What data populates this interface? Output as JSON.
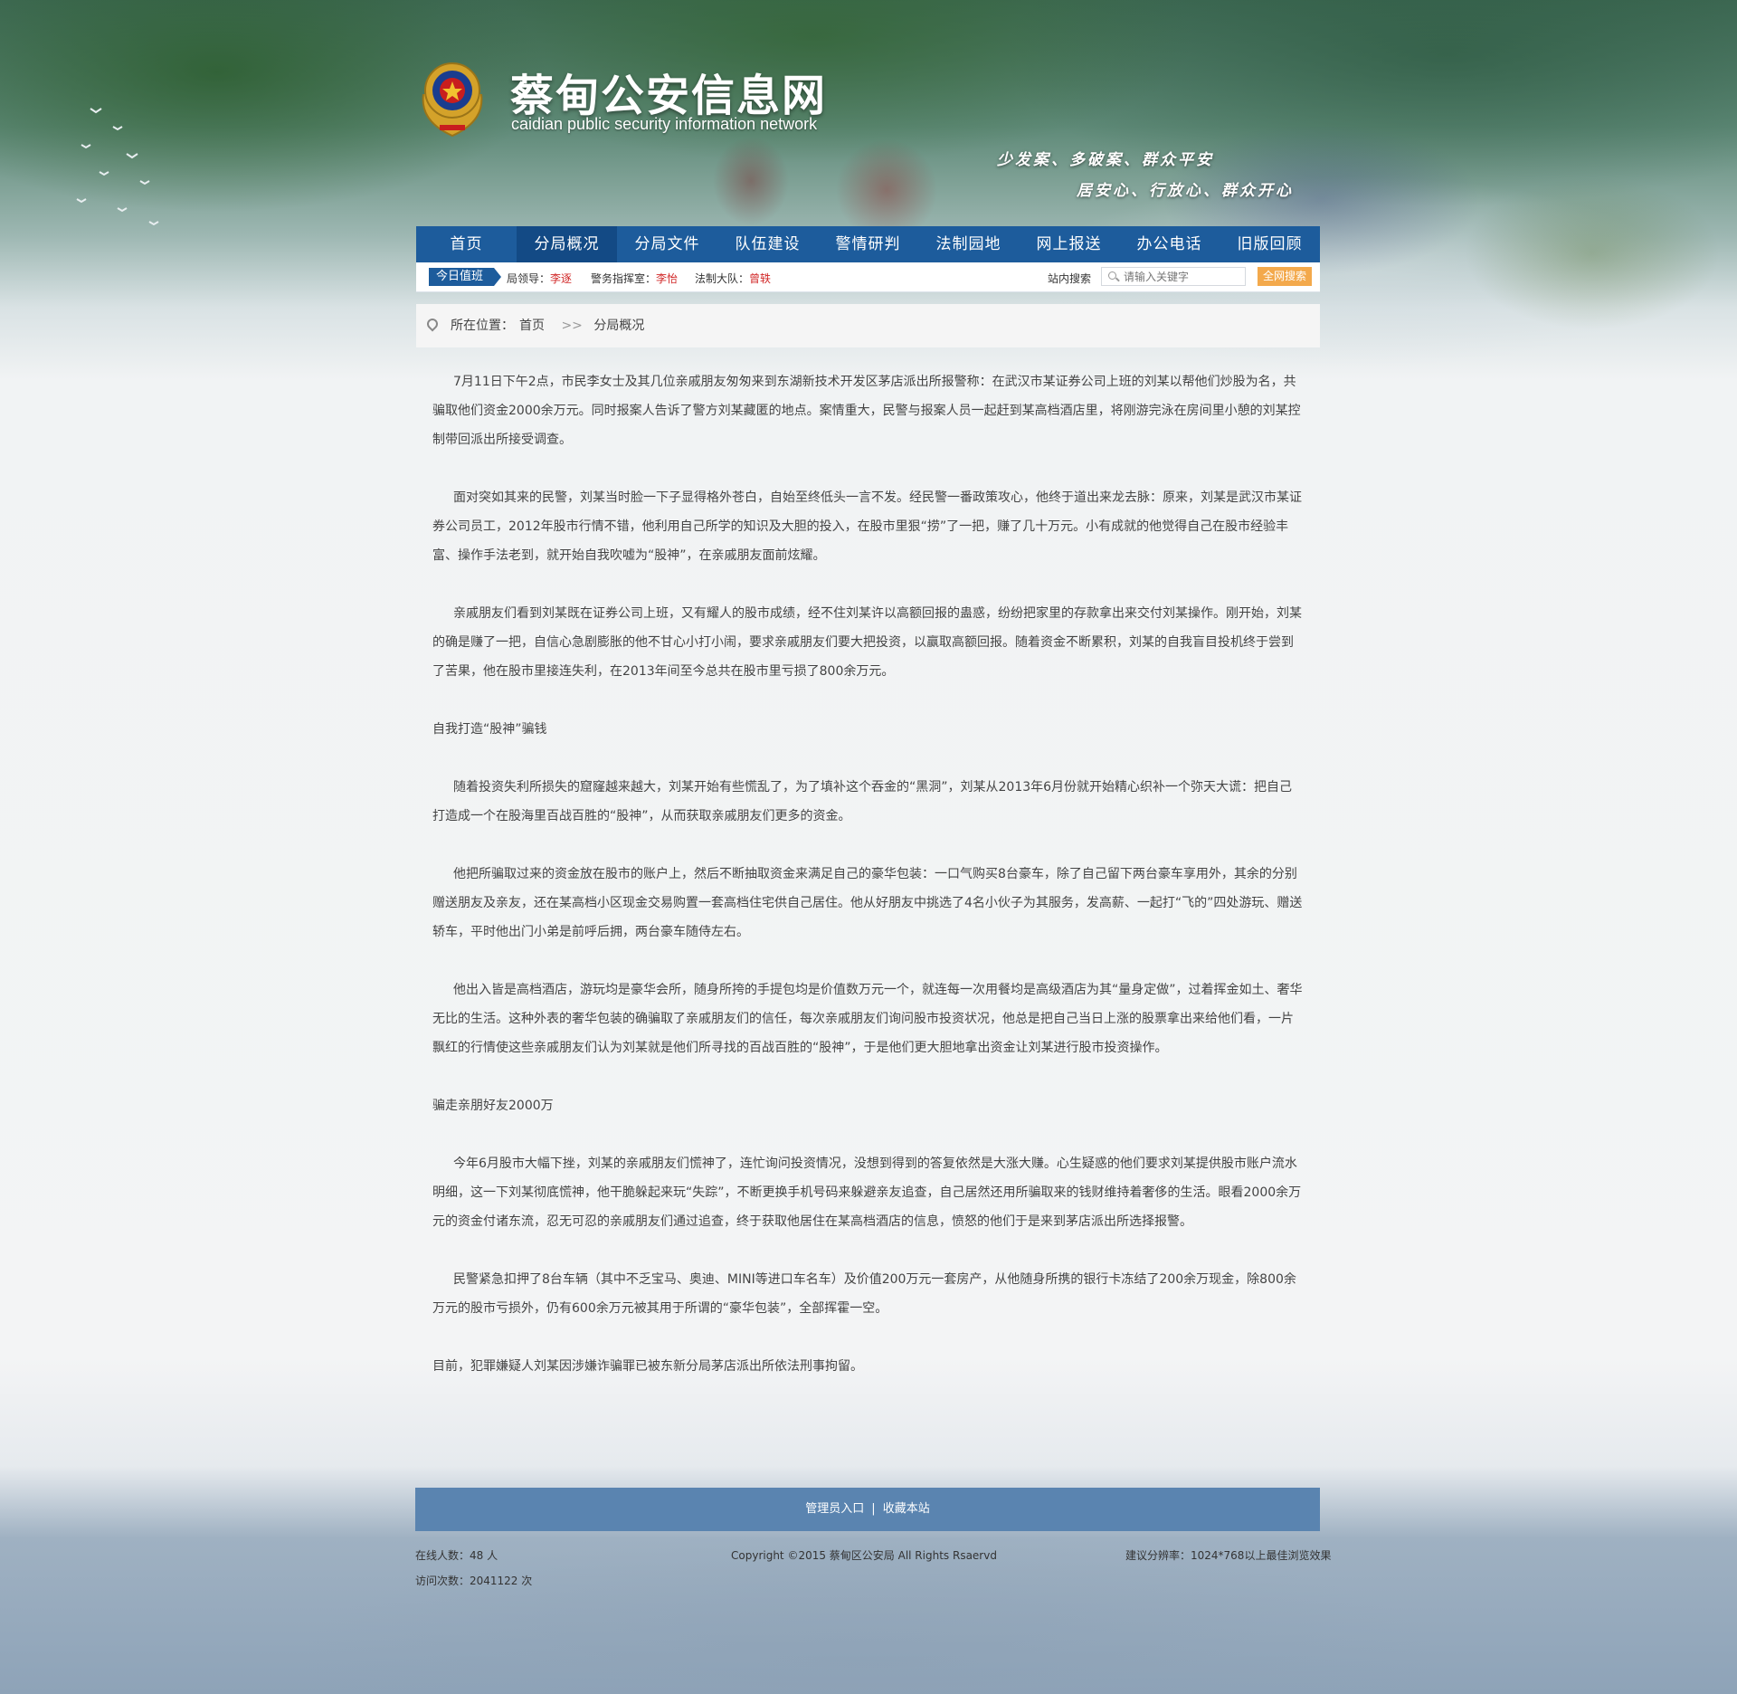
{
  "site": {
    "title": "蔡甸公安信息网",
    "subtitle": "caidian  public security information network",
    "slogan1": "少发案、多破案、群众平安",
    "slogan2": "居安心、行放心、群众开心"
  },
  "nav": {
    "items": [
      "首页",
      "分局概况",
      "分局文件",
      "队伍建设",
      "警情研判",
      "法制园地",
      "网上报送",
      "办公电话",
      "旧版回顾"
    ],
    "active_index": 1
  },
  "duty": {
    "tag": "今日值班",
    "leaders": [
      {
        "role": "局领导：",
        "name": "李逐"
      },
      {
        "role": "警务指挥室：",
        "name": "李怡"
      },
      {
        "role": "法制大队：",
        "name": "曾轶"
      }
    ],
    "search_label": "站内搜索",
    "search_placeholder": "请输入关键字",
    "search_button": "全网搜索"
  },
  "breadcrumb": {
    "prefix": "所在位置：",
    "home": "首页",
    "sep": ">>",
    "current": "分局概况"
  },
  "article": {
    "paragraphs": [
      {
        "indent": true,
        "text": "7月11日下午2点，市民李女士及其几位亲戚朋友匆匆来到东湖新技术开发区茅店派出所报警称：在武汉市某证券公司上班的刘某以帮他们炒股为名，共骗取他们资金2000余万元。同时报案人告诉了警方刘某藏匿的地点。案情重大，民警与报案人员一起赶到某高档酒店里，将刚游完泳在房间里小憩的刘某控制带回派出所接受调查。"
      },
      {
        "indent": true,
        "text": "面对突如其来的民警，刘某当时脸一下子显得格外苍白，自始至终低头一言不发。经民警一番政策攻心，他终于道出来龙去脉：原来，刘某是武汉市某证券公司员工，2012年股市行情不错，他利用自己所学的知识及大胆的投入，在股市里狠“捞”了一把，赚了几十万元。小有成就的他觉得自己在股市经验丰富、操作手法老到，就开始自我吹嘘为“股神”，在亲戚朋友面前炫耀。"
      },
      {
        "indent": true,
        "text": "亲戚朋友们看到刘某既在证券公司上班，又有耀人的股市成绩，经不住刘某许以高额回报的蛊惑，纷纷把家里的存款拿出来交付刘某操作。刚开始，刘某的确是赚了一把，自信心急剧膨胀的他不甘心小打小闹，要求亲戚朋友们要大把投资，以赢取高额回报。随着资金不断累积，刘某的自我盲目投机终于尝到了苦果，他在股市里接连失利，在2013年间至今总共在股市里亏损了800余万元。"
      },
      {
        "indent": false,
        "text": "自我打造“股神”骗钱"
      },
      {
        "indent": true,
        "text": "随着投资失利所损失的窟窿越来越大，刘某开始有些慌乱了，为了填补这个吞金的“黑洞”，刘某从2013年6月份就开始精心织补一个弥天大谎：把自己打造成一个在股海里百战百胜的“股神”，从而获取亲戚朋友们更多的资金。"
      },
      {
        "indent": true,
        "text": "他把所骗取过来的资金放在股市的账户上，然后不断抽取资金来满足自己的豪华包装：一口气购买8台豪车，除了自己留下两台豪车享用外，其余的分别赠送朋友及亲友，还在某高档小区现金交易购置一套高档住宅供自己居住。他从好朋友中挑选了4名小伙子为其服务，发高薪、一起打“飞的”四处游玩、赠送轿车，平时他出门小弟是前呼后拥，两台豪车随侍左右。"
      },
      {
        "indent": true,
        "text": "他出入皆是高档酒店，游玩均是豪华会所，随身所挎的手提包均是价值数万元一个，就连每一次用餐均是高级酒店为其“量身定做”，过着挥金如土、奢华无比的生活。这种外表的奢华包装的确骗取了亲戚朋友们的信任，每次亲戚朋友们询问股市投资状况，他总是把自己当日上涨的股票拿出来给他们看，一片飘红的行情使这些亲戚朋友们认为刘某就是他们所寻找的百战百胜的“股神”，于是他们更大胆地拿出资金让刘某进行股市投资操作。"
      },
      {
        "indent": false,
        "text": "骗走亲朋好友2000万"
      },
      {
        "indent": true,
        "text": "今年6月股市大幅下挫，刘某的亲戚朋友们慌神了，连忙询问投资情况，没想到得到的答复依然是大涨大赚。心生疑惑的他们要求刘某提供股市账户流水明细，这一下刘某彻底慌神，他干脆躲起来玩“失踪”，不断更换手机号码来躲避亲友追查，自己居然还用所骗取来的钱财维持着奢侈的生活。眼看2000余万元的资金付诸东流，忍无可忍的亲戚朋友们通过追查，终于获取他居住在某高档酒店的信息，愤怒的他们于是来到茅店派出所选择报警。"
      },
      {
        "indent": true,
        "text": "民警紧急扣押了8台车辆（其中不乏宝马、奥迪、MINI等进口车名车）及价值200万元一套房产，从他随身所携的银行卡冻结了200余万现金，除800余万元的股市亏损外，仍有600余万元被其用于所谓的“豪华包装”，全部挥霍一空。"
      },
      {
        "indent": false,
        "text": "目前，犯罪嫌疑人刘某因涉嫌诈骗罪已被东新分局茅店派出所依法刑事拘留。"
      }
    ]
  },
  "footer": {
    "admin_link": "管理员入口",
    "divider": "|",
    "bookmark_link": "收藏本站",
    "online": "在线人数：48 人",
    "visits": "访问次数：2041122 次",
    "copyright": "Copyright ©2015  蔡甸区公安局  All Rights Rsaervd",
    "resolution": "建议分辨率：1024*768以上最佳浏览效果"
  }
}
